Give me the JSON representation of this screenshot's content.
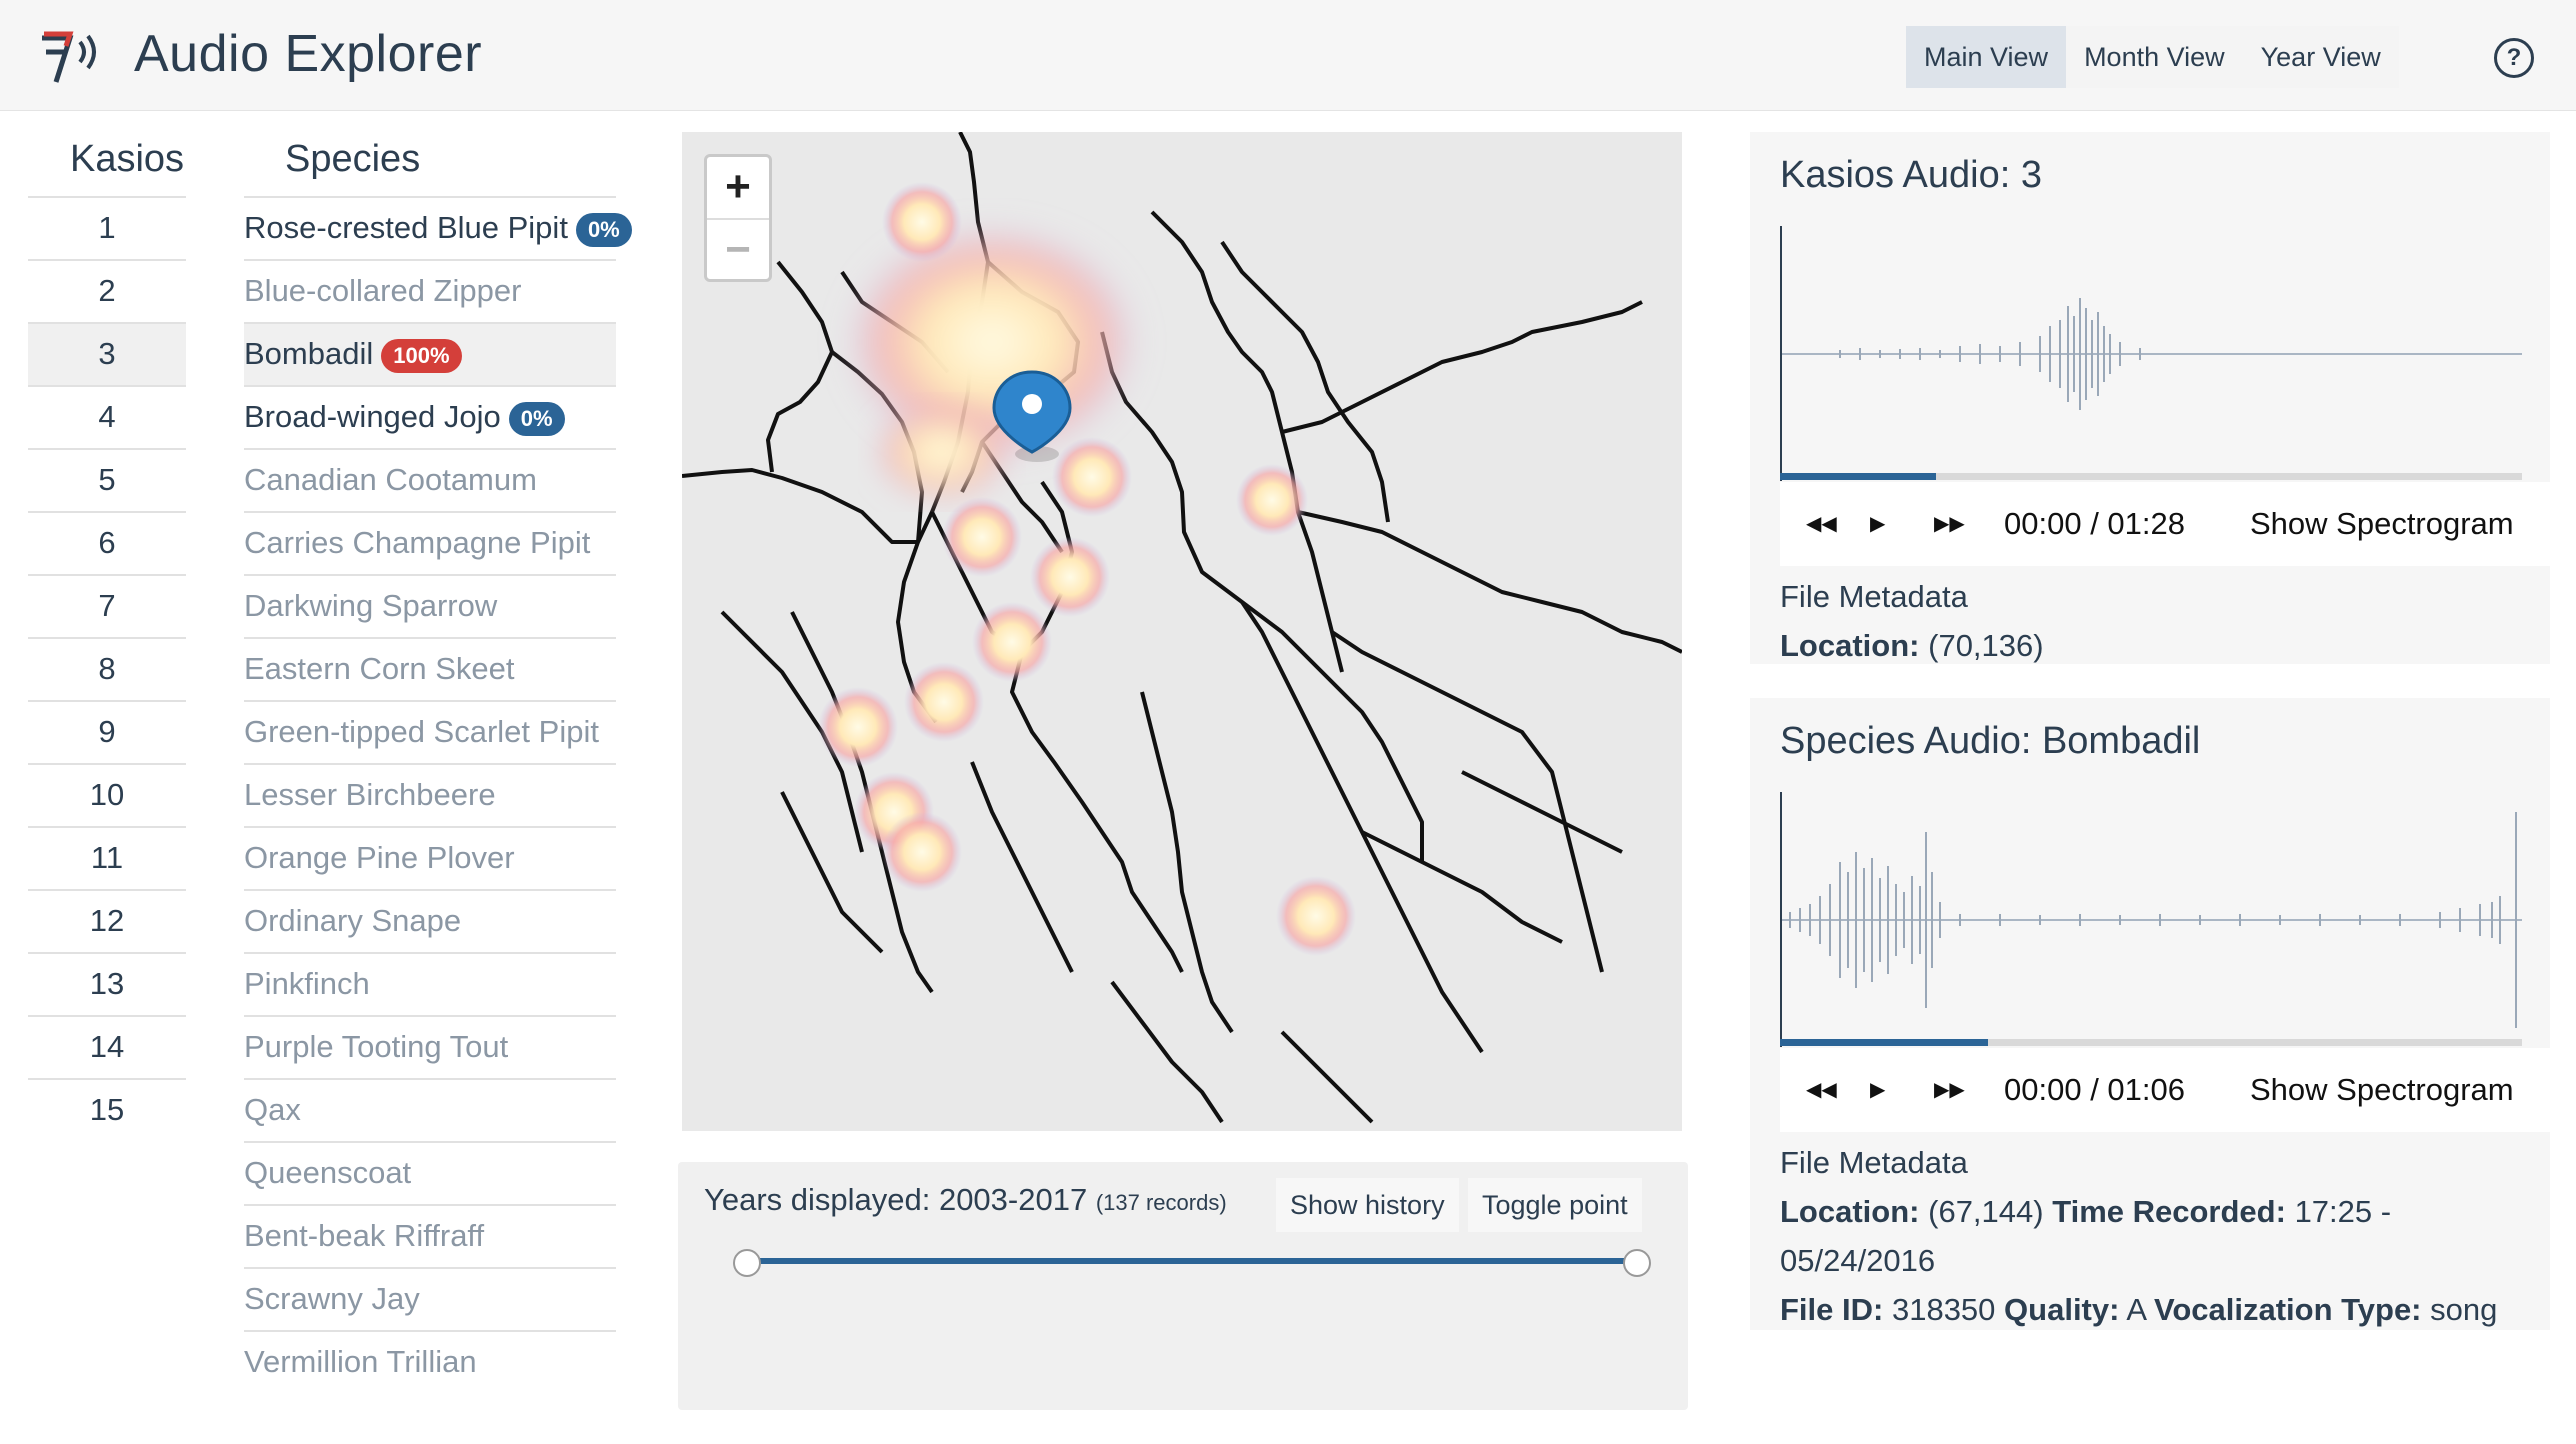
{
  "header": {
    "app_title": "Audio Explorer",
    "views": [
      "Main View",
      "Month View",
      "Year View"
    ],
    "active_view": "Main View",
    "help_glyph": "?"
  },
  "table": {
    "kasios_header": "Kasios",
    "species_header": "Species",
    "kasios": [
      "1",
      "2",
      "3",
      "4",
      "5",
      "6",
      "7",
      "8",
      "9",
      "10",
      "11",
      "12",
      "13",
      "14",
      "15"
    ],
    "selected_kasios": "3",
    "species": [
      {
        "name": "Rose-crested Blue Pipit",
        "badge": "0%",
        "badge_color": "#2b6496"
      },
      {
        "name": "Blue-collared Zipper"
      },
      {
        "name": "Bombadil",
        "badge": "100%",
        "badge_color": "#d43f3a"
      },
      {
        "name": "Broad-winged Jojo",
        "badge": "0%",
        "badge_color": "#2b6496"
      },
      {
        "name": "Canadian Cootamum"
      },
      {
        "name": "Carries Champagne Pipit"
      },
      {
        "name": "Darkwing Sparrow"
      },
      {
        "name": "Eastern Corn Skeet"
      },
      {
        "name": "Green-tipped Scarlet Pipit"
      },
      {
        "name": "Lesser Birchbeere"
      },
      {
        "name": "Orange Pine Plover"
      },
      {
        "name": "Ordinary Snape"
      },
      {
        "name": "Pinkfinch"
      },
      {
        "name": "Purple Tooting Tout"
      },
      {
        "name": "Qax"
      },
      {
        "name": "Queenscoat"
      },
      {
        "name": "Bent-beak Riffraff"
      },
      {
        "name": "Scrawny Jay"
      },
      {
        "name": "Vermillion Trillian"
      }
    ],
    "selected_species": "Bombadil"
  },
  "map": {
    "zoom_in": "+",
    "zoom_out": "−",
    "marker_icon": "map-pin-icon"
  },
  "timeline": {
    "years_label": "Years displayed: 2003-2017",
    "records": "(137 records)",
    "show_history": "Show history",
    "toggle_point": "Toggle point"
  },
  "kasios_audio": {
    "title": "Kasios Audio: 3",
    "time": "00:00 / 01:28",
    "spectrogram": "Show Spectrogram",
    "meta_heading": "File Metadata",
    "location_label": "Location:",
    "location_value": "(70,136)",
    "progress": 0.21
  },
  "species_audio": {
    "title": "Species Audio: Bombadil",
    "time": "00:00 / 01:06",
    "spectrogram": "Show Spectrogram",
    "meta_heading": "File Metadata",
    "location_label": "Location:",
    "location_value": "(67,144)",
    "time_recorded_label": "Time Recorded:",
    "time_recorded_value": "17:25 - 05/24/2016",
    "file_id_label": "File ID:",
    "file_id_value": "318350",
    "quality_label": "Quality:",
    "quality_value": "A",
    "vocalization_label": "Vocalization Type:",
    "vocalization_value": "song",
    "progress": 0.28
  },
  "player_icons": [
    "rewind-icon",
    "play-icon",
    "fast-forward-icon"
  ],
  "colors": {
    "accent": "#2b6496",
    "danger": "#d43f3a",
    "text": "#2c3e50",
    "muted_text": "#8b97a4",
    "waveform": "#9aa8b8"
  }
}
